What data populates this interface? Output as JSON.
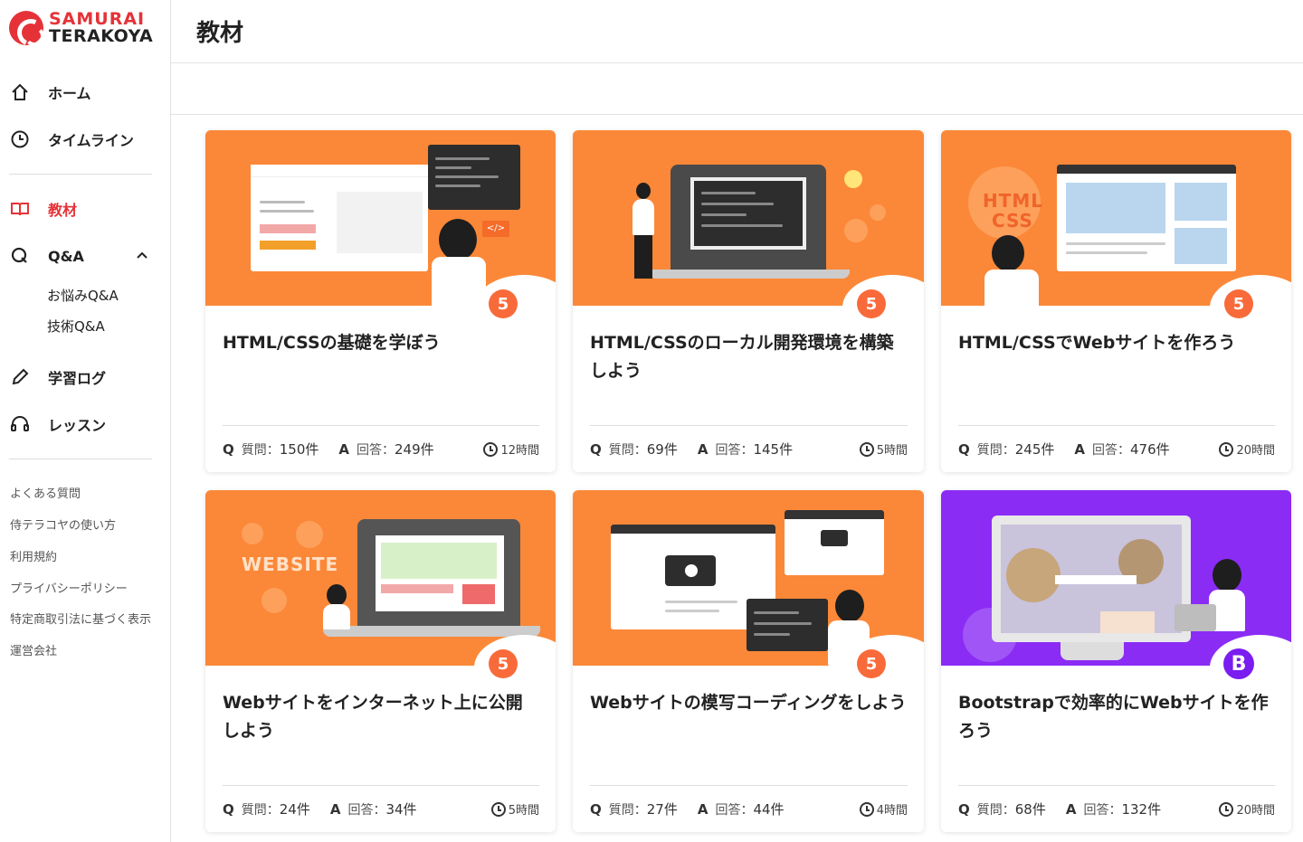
{
  "logo": {
    "line1": "SAMURAI",
    "line2": "TERAKOYA"
  },
  "nav": {
    "home": "ホーム",
    "timeline": "タイムライン",
    "materials": "教材",
    "qa": "Q&A",
    "qa_sub": [
      "お悩みQ&A",
      "技術Q&A"
    ],
    "log": "学習ログ",
    "lesson": "レッスン"
  },
  "footer_links": [
    "よくある質問",
    "侍テラコヤの使い方",
    "利用規約",
    "プライバシーポリシー",
    "特定商取引法に基づく表示",
    "運営会社"
  ],
  "page_title": "教材",
  "labels": {
    "q": "Q",
    "a": "A",
    "question": "質問：",
    "answer": "回答："
  },
  "cards": [
    {
      "title": "HTML/CSSの基礎を学ぼう",
      "questions": "150件",
      "answers": "249件",
      "time": "12時間",
      "badge": "5",
      "color": "#fb8838"
    },
    {
      "title": "HTML/CSSのローカル開発環境を構築しよう",
      "questions": "69件",
      "answers": "145件",
      "time": "5時間",
      "badge": "5",
      "color": "#fb8838"
    },
    {
      "title": "HTML/CSSでWebサイトを作ろう",
      "questions": "245件",
      "answers": "476件",
      "time": "20時間",
      "badge": "5",
      "color": "#fb8838",
      "thumb_words": [
        "HTML",
        "CSS"
      ]
    },
    {
      "title": "Webサイトをインターネット上に公開しよう",
      "questions": "24件",
      "answers": "34件",
      "time": "5時間",
      "badge": "5",
      "color": "#fb8838",
      "thumb_words": [
        "WEBSITE"
      ]
    },
    {
      "title": "Webサイトの模写コーディングをしよう",
      "questions": "27件",
      "answers": "44件",
      "time": "4時間",
      "badge": "5",
      "color": "#fb8838"
    },
    {
      "title": "Bootstrapで効率的にWebサイトを作ろう",
      "questions": "68件",
      "answers": "132件",
      "time": "20時間",
      "badge": "B",
      "color": "#8b2cf5"
    }
  ]
}
